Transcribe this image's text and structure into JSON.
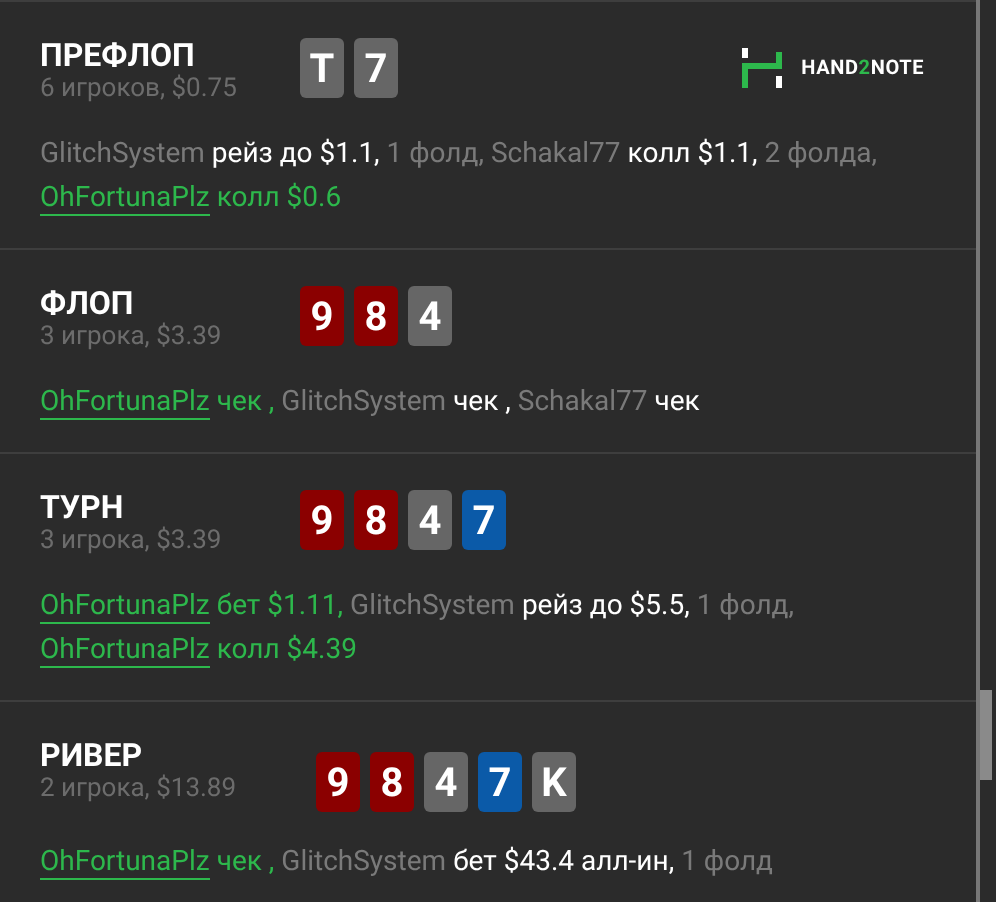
{
  "logo": {
    "before": "HAND",
    "accent": "2",
    "after": "NOTE"
  },
  "streets": [
    {
      "title": "ПРЕФЛОП",
      "subtitle": "6 игроков, $0.75",
      "cards": [
        {
          "rank": "T",
          "color": "#666666"
        },
        {
          "rank": "7",
          "color": "#666666"
        }
      ],
      "actions": [
        {
          "kind": "name",
          "text": "GlitchSystem"
        },
        {
          "kind": "action",
          "text": "рейз до $1.1,"
        },
        {
          "kind": "fold",
          "text": "1 фолд,"
        },
        {
          "kind": "name",
          "text": "Schakal77"
        },
        {
          "kind": "action",
          "text": "колл $1.1,"
        },
        {
          "kind": "fold",
          "text": "2 фолда,"
        },
        {
          "kind": "hero",
          "text": "OhFortunaPlz"
        },
        {
          "kind": "hero-action",
          "text": "колл $0.6"
        }
      ]
    },
    {
      "title": "ФЛОП",
      "subtitle": "3 игрока, $3.39",
      "cards": [
        {
          "rank": "9",
          "color": "#8b0000"
        },
        {
          "rank": "8",
          "color": "#8b0000"
        },
        {
          "rank": "4",
          "color": "#666666"
        }
      ],
      "actions": [
        {
          "kind": "hero",
          "text": "OhFortunaPlz"
        },
        {
          "kind": "hero-action",
          "text": "чек ,"
        },
        {
          "kind": "name",
          "text": "GlitchSystem"
        },
        {
          "kind": "action",
          "text": "чек ,"
        },
        {
          "kind": "name",
          "text": "Schakal77"
        },
        {
          "kind": "action",
          "text": "чек"
        }
      ]
    },
    {
      "title": "ТУРН",
      "subtitle": "3 игрока, $3.39",
      "cards": [
        {
          "rank": "9",
          "color": "#8b0000"
        },
        {
          "rank": "8",
          "color": "#8b0000"
        },
        {
          "rank": "4",
          "color": "#666666"
        },
        {
          "rank": "7",
          "color": "#0b5aa8"
        }
      ],
      "actions": [
        {
          "kind": "hero",
          "text": "OhFortunaPlz"
        },
        {
          "kind": "hero-action",
          "text": "бет $1.11,"
        },
        {
          "kind": "name",
          "text": "GlitchSystem"
        },
        {
          "kind": "action",
          "text": "рейз до $5.5,"
        },
        {
          "kind": "fold",
          "text": "1 фолд,"
        },
        {
          "kind": "hero",
          "text": "OhFortunaPlz"
        },
        {
          "kind": "hero-action",
          "text": "колл $4.39"
        }
      ]
    },
    {
      "title": "РИВЕР",
      "subtitle": "2 игрока, $13.89",
      "cards": [
        {
          "rank": "9",
          "color": "#8b0000"
        },
        {
          "rank": "8",
          "color": "#8b0000"
        },
        {
          "rank": "4",
          "color": "#666666"
        },
        {
          "rank": "7",
          "color": "#0b5aa8"
        },
        {
          "rank": "K",
          "color": "#666666"
        }
      ],
      "actions": [
        {
          "kind": "hero",
          "text": "OhFortunaPlz"
        },
        {
          "kind": "hero-action",
          "text": "чек ,"
        },
        {
          "kind": "name",
          "text": "GlitchSystem"
        },
        {
          "kind": "action",
          "text": "бет $43.4 алл-ин,"
        },
        {
          "kind": "fold",
          "text": "1 фолд"
        }
      ]
    }
  ]
}
